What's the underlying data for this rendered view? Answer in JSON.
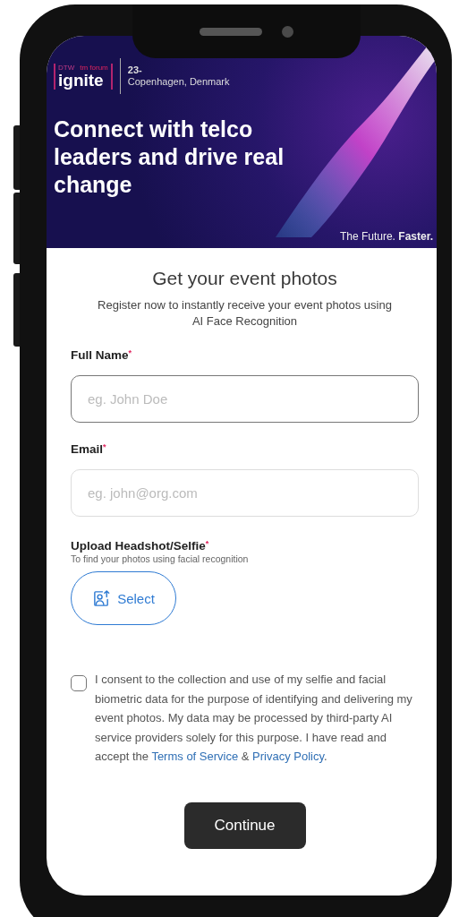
{
  "banner": {
    "logo": {
      "top_left": "DTW",
      "top_right": "tm forum",
      "word": "ignite"
    },
    "date": "23-",
    "location": "Copenhagen, Denmark",
    "headline": "Connect with telco leaders and drive real change",
    "tagline": "The Future. **Faster.**"
  },
  "form": {
    "title": "Get your event photos",
    "subtitle": "Register now to instantly receive your event photos using AI Face Recognition",
    "fields": [
      {
        "label": "Full Name",
        "required": "*",
        "placeholder": "eg. John Doe",
        "focused": true
      },
      {
        "label": "Email",
        "required": "*",
        "placeholder": "eg. john@org.com",
        "focused": false
      }
    ],
    "upload": {
      "label": "Upload Headshot/Selfie",
      "required": "*",
      "hint": "To find your photos using facial recognition",
      "button": "Select"
    },
    "consent": {
      "checked": false,
      "text": "I consent to the collection and use of my selfie and facial biometric data for the purpose of identifying and delivering my event photos. My data may be processed by third-party AI service providers solely for this purpose. I have read and accept the",
      "terms_link": "Terms of Service",
      "joiner": "&",
      "privacy_link": "Privacy Policy",
      "end": "."
    },
    "submit": "Continue"
  }
}
